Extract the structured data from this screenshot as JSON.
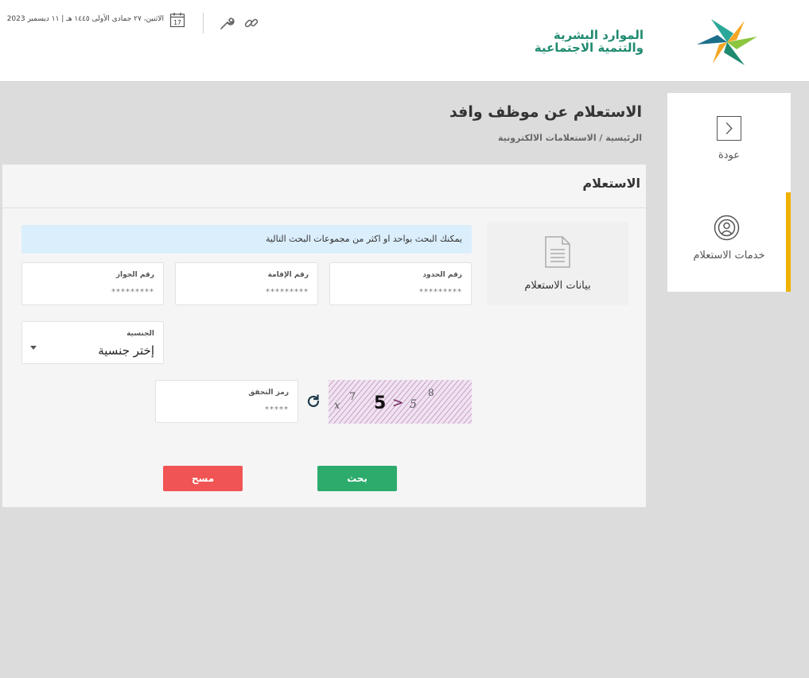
{
  "header": {
    "logo_line1": "الموارد البشرية",
    "logo_line2": "والتنمية الاجتماعية",
    "date": "الاثنين، ٢٧ جمادى الأولى ١٤٤٥ هـ | ١١ ديسمبر 2023",
    "calendar_day": "17",
    "icons": [
      "link-icon",
      "wrench-icon",
      "calendar-icon"
    ]
  },
  "sidebar": {
    "back_label": "عودة",
    "services_label": "خدمات الاستعلام"
  },
  "page": {
    "title": "الاستعلام عن موظف وافد",
    "breadcrumb": "الرئيسية / الاستعلامات الالكترونية"
  },
  "panel": {
    "title": "الاستعلام",
    "info_label": "بيانات الاستعلام",
    "notice": "يمكنك البحث بواحد او اكثر من مجموعات البحث التالية"
  },
  "fields": {
    "border_number": {
      "label": "رقم الحدود",
      "value": "*********"
    },
    "iqama_number": {
      "label": "رقم الإقامة",
      "value": "*********"
    },
    "passport_number": {
      "label": "رقم الجواز",
      "value": "*********"
    },
    "nationality": {
      "label": "الجنسية",
      "value": "إختر جنسية"
    },
    "captcha": {
      "label": "رمز التحقق",
      "value": "*****"
    }
  },
  "captcha_chars": [
    "x",
    "7",
    "5",
    ">",
    "5",
    "8"
  ],
  "buttons": {
    "search": "بحث",
    "clear": "مسح"
  },
  "colors": {
    "accent": "#f0b100",
    "search": "#2dab6c",
    "clear": "#f05454",
    "notice_bg": "#dbeefc",
    "brand_green": "#1f8a70"
  }
}
